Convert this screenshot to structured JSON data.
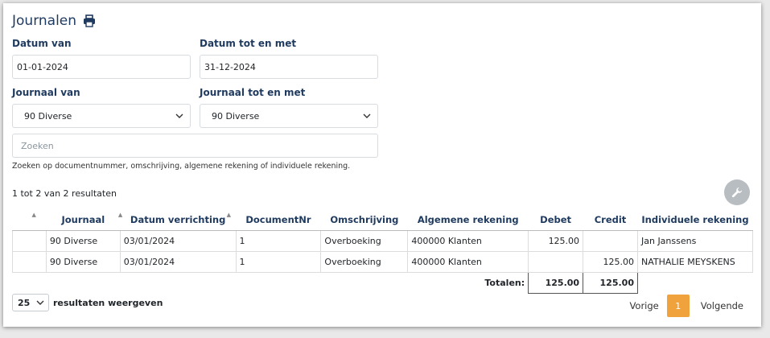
{
  "page": {
    "title": "Journalen"
  },
  "filters": {
    "date_from_label": "Datum van",
    "date_from_value": "01-01-2024",
    "date_to_label": "Datum tot en met",
    "date_to_value": "31-12-2024",
    "journal_from_label": "Journaal van",
    "journal_from_value": "90 Diverse",
    "journal_to_label": "Journaal tot en met",
    "journal_to_value": "90 Diverse",
    "search_placeholder": "Zoeken",
    "search_help": "Zoeken op documentnummer, omschrijving, algemene rekening of individuele rekening."
  },
  "results": {
    "count_text": "1 tot 2 van 2 resultaten"
  },
  "table": {
    "headers": [
      "",
      "Journaal",
      "Datum verrichting",
      "DocumentNr",
      "Omschrijving",
      "Algemene rekening",
      "Debet",
      "Credit",
      "Individuele rekening"
    ],
    "rows": [
      [
        "",
        "90 Diverse",
        "03/01/2024",
        "1",
        "Overboeking",
        "400000 Klanten",
        "125.00",
        "",
        "Jan Janssens"
      ],
      [
        "",
        "90 Diverse",
        "03/01/2024",
        "1",
        "Overboeking",
        "400000 Klanten",
        "",
        "125.00",
        "NATHALIE MEYSKENS"
      ]
    ],
    "totals_label": "Totalen:",
    "totals_debet": "125.00",
    "totals_credit": "125.00"
  },
  "pagination": {
    "page_size": "25",
    "page_size_label": "resultaten weergeven",
    "prev_label": "Vorige",
    "current_page": "1",
    "next_label": "Volgende"
  },
  "icons": {
    "title": "printer-icon",
    "tool": "wrench-icon",
    "select": "chevron-down-icon"
  },
  "colors": {
    "heading": "#1f3a5f",
    "active_page": "#f0a33c"
  }
}
